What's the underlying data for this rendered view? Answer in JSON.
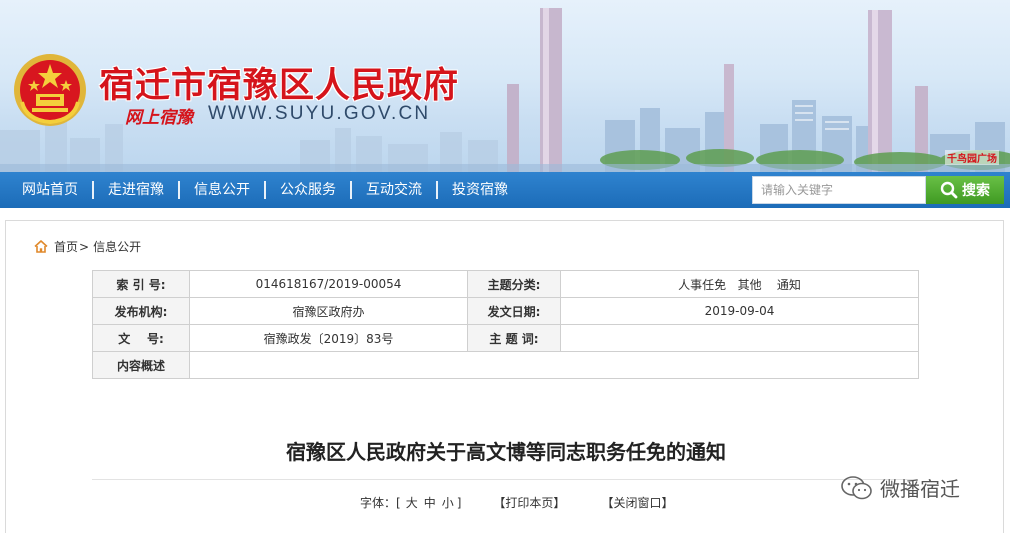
{
  "header": {
    "site_title": "宿迁市宿豫区人民政府",
    "slogan": "网上宿豫",
    "url": "WWW.SUYU.GOV.CN",
    "place_tag": "千鸟园广场",
    "colors": {
      "title_red": "#d5141b",
      "sky": "#d7e8f7"
    },
    "emblem_icon": "national-emblem-icon"
  },
  "nav": {
    "items": [
      {
        "label": "网站首页"
      },
      {
        "label": "走进宿豫"
      },
      {
        "label": "信息公开"
      },
      {
        "label": "公众服务"
      },
      {
        "label": "互动交流"
      },
      {
        "label": "投资宿豫"
      }
    ],
    "colors": {
      "bar": "#1f73c0"
    }
  },
  "search": {
    "placeholder": "请输入关键字",
    "button_label": "搜索",
    "button_icon": "magnifier-icon",
    "colors": {
      "button": "#4aa52b"
    }
  },
  "breadcrumb": {
    "home": "首页",
    "separator": ">",
    "current": "信息公开",
    "home_icon": "home-icon"
  },
  "meta": {
    "index_label": "索 引 号:",
    "index_value": "014618167/2019-00054",
    "category_label": "主题分类:",
    "category_value": "人事任免   其他    通知",
    "publisher_label": "发布机构:",
    "publisher_value": "宿豫区政府办",
    "date_label": "发文日期:",
    "date_value": "2019-09-04",
    "docno_label": "文    号:",
    "docno_value": "宿豫政发〔2019〕83号",
    "keywords_label": "主 题 词:",
    "keywords_value": "",
    "summary_label": "内容概述",
    "summary_value": ""
  },
  "article": {
    "title": "宿豫区人民政府关于高文博等同志职务任免的通知",
    "font_label": "字体：[",
    "font_large": "大",
    "font_medium": "中",
    "font_small": "小",
    "font_close": "]",
    "print_label": "【打印本页】",
    "close_label": "【关闭窗口】"
  },
  "watermark": {
    "text": "微播宿迁",
    "icon": "wechat-icon"
  }
}
